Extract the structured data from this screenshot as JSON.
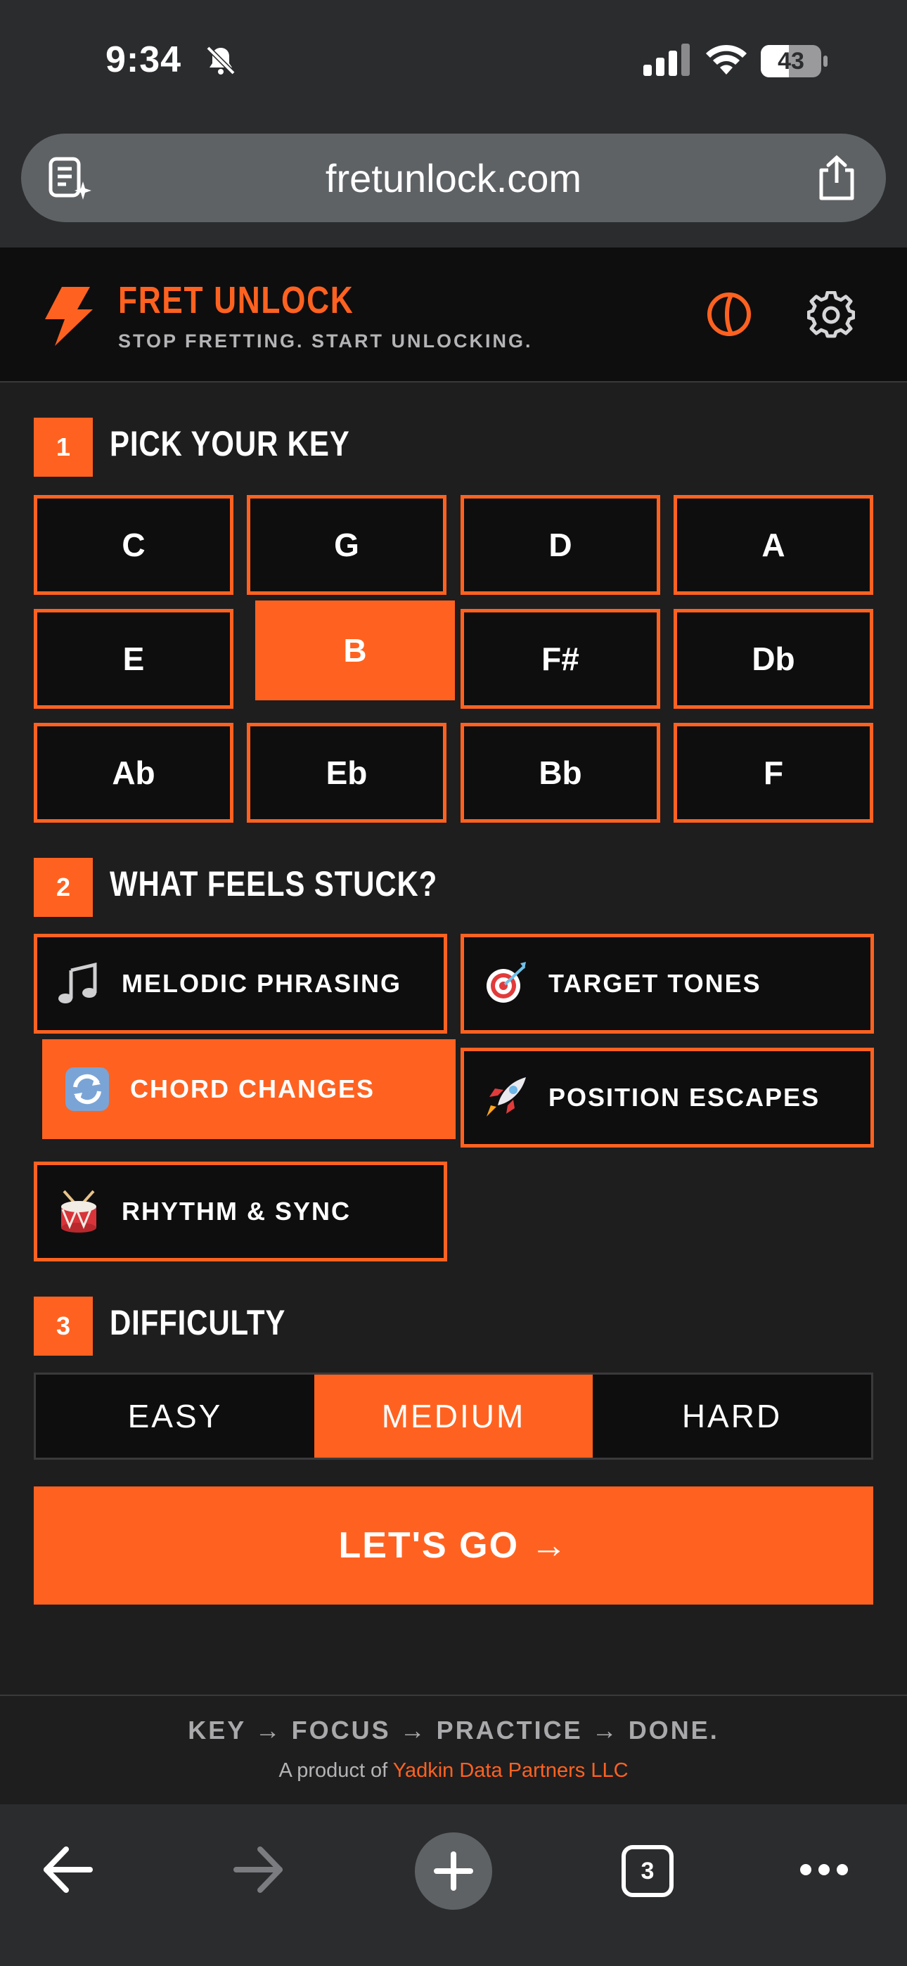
{
  "status_bar": {
    "time": "9:34",
    "battery": "43",
    "icons": [
      "bell-slash-icon",
      "signal-icon",
      "wifi-icon",
      "battery-icon"
    ]
  },
  "browser": {
    "url": "fretunlock.com",
    "icons": [
      "reader-icon",
      "share-icon"
    ]
  },
  "header": {
    "brand": "FRET UNLOCK",
    "tagline": "STOP FRETTING. START UNLOCKING.",
    "icons": [
      "bolt-icon",
      "guitar-pick-icon",
      "gear-icon"
    ],
    "accent_color": "#ff6220"
  },
  "step1": {
    "number": "1",
    "title": "PICK YOUR KEY",
    "keys": [
      "C",
      "G",
      "D",
      "A",
      "E",
      "B",
      "F#",
      "Db",
      "Ab",
      "Eb",
      "Bb",
      "F"
    ],
    "selected": "B"
  },
  "step2": {
    "number": "2",
    "title": "WHAT FEELS STUCK?",
    "options": [
      {
        "label": "MELODIC PHRASING",
        "icon": "music-notes-icon"
      },
      {
        "label": "TARGET TONES",
        "icon": "target-icon"
      },
      {
        "label": "CHORD CHANGES",
        "icon": "cycle-arrows-icon"
      },
      {
        "label": "POSITION ESCAPES",
        "icon": "rocket-icon"
      },
      {
        "label": "RHYTHM & SYNC",
        "icon": "drum-icon"
      }
    ],
    "selected": "CHORD CHANGES"
  },
  "step3": {
    "number": "3",
    "title": "DIFFICULTY",
    "levels": [
      "EASY",
      "MEDIUM",
      "HARD"
    ],
    "selected": "MEDIUM"
  },
  "cta": {
    "label": "LET'S GO →"
  },
  "footer": {
    "flow": "KEY → FOCUS → PRACTICE → DONE.",
    "credit_prefix": "A product of ",
    "company": "Yadkin Data Partners LLC"
  },
  "toolbar": {
    "tab_count": "3",
    "icons": [
      "back-arrow-icon",
      "forward-arrow-icon",
      "plus-icon",
      "tabs-icon",
      "more-icon"
    ]
  }
}
